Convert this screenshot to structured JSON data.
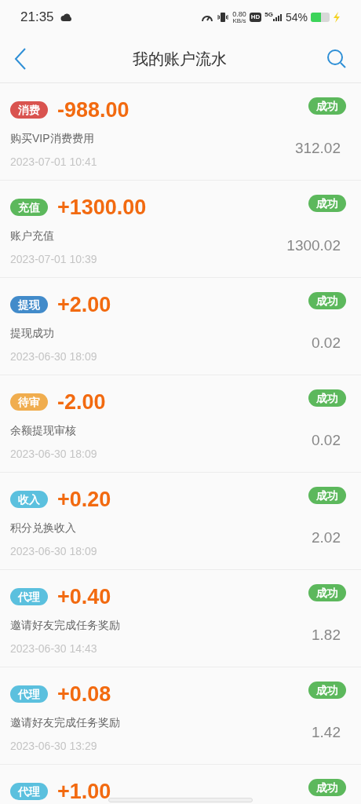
{
  "status_bar": {
    "time": "21:35",
    "speed_value": "0.80",
    "speed_unit": "KB/s",
    "hd": "HD",
    "network": "5G",
    "battery": "54%"
  },
  "header": {
    "title": "我的账户流水"
  },
  "records": [
    {
      "tag": "消费",
      "color": "#d9534f",
      "amount": "-988.00",
      "status": "成功",
      "description": "购买VIP消费费用",
      "time": "2023-07-01 10:41",
      "balance": "312.02"
    },
    {
      "tag": "充值",
      "color": "#5cb85c",
      "amount": "+1300.00",
      "status": "成功",
      "description": "账户充值",
      "time": "2023-07-01 10:39",
      "balance": "1300.02"
    },
    {
      "tag": "提现",
      "color": "#428bca",
      "amount": "+2.00",
      "status": "成功",
      "description": "提现成功",
      "time": "2023-06-30 18:09",
      "balance": "0.02"
    },
    {
      "tag": "待审",
      "color": "#f0ad4e",
      "amount": "-2.00",
      "status": "成功",
      "description": "余额提现审核",
      "time": "2023-06-30 18:09",
      "balance": "0.02"
    },
    {
      "tag": "收入",
      "color": "#5bc0de",
      "amount": "+0.20",
      "status": "成功",
      "description": "积分兑换收入",
      "time": "2023-06-30 18:09",
      "balance": "2.02"
    },
    {
      "tag": "代理",
      "color": "#5bc0de",
      "amount": "+0.40",
      "status": "成功",
      "description": "邀请好友完成任务奖励",
      "time": "2023-06-30 14:43",
      "balance": "1.82"
    },
    {
      "tag": "代理",
      "color": "#5bc0de",
      "amount": "+0.08",
      "status": "成功",
      "description": "邀请好友完成任务奖励",
      "time": "2023-06-30 13:29",
      "balance": "1.42"
    },
    {
      "tag": "代理",
      "color": "#5bc0de",
      "amount": "+1.00",
      "status": "成功"
    }
  ]
}
